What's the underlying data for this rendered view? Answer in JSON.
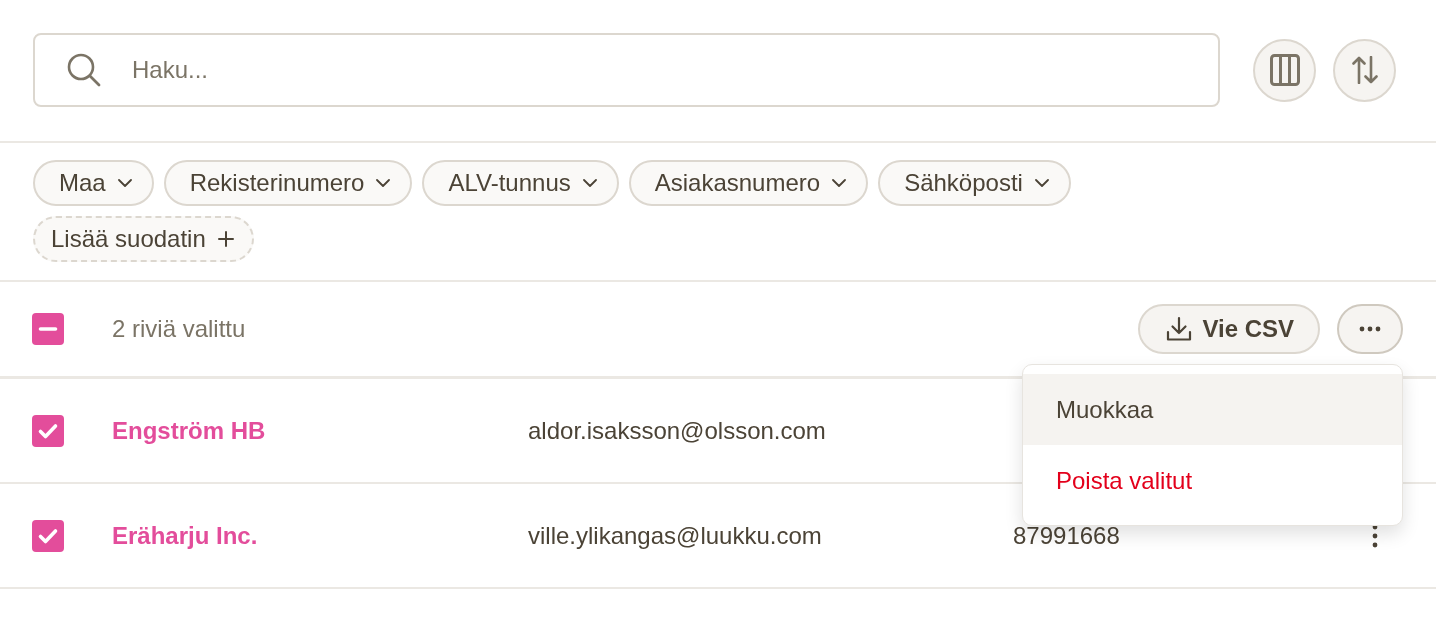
{
  "search": {
    "placeholder": "Haku..."
  },
  "view_buttons": [
    {
      "kind": "columns"
    },
    {
      "kind": "sort"
    }
  ],
  "filters": [
    {
      "label": "Maa",
      "kind": "dropdown"
    },
    {
      "label": "Rekisterinumero",
      "kind": "dropdown"
    },
    {
      "label": "ALV-tunnus",
      "kind": "dropdown"
    },
    {
      "label": "Asiakasnumero",
      "kind": "dropdown"
    },
    {
      "label": "Sähköposti",
      "kind": "dropdown"
    },
    {
      "label": "Lisää suodatin",
      "kind": "add"
    }
  ],
  "selection": {
    "indeterminate": true,
    "label": "2 riviä valittu"
  },
  "actions": {
    "export_label": "Vie CSV",
    "menu_open": true
  },
  "menu": [
    {
      "label": "Muokkaa",
      "kind": "normal",
      "highlighted": true
    },
    {
      "label": "Poista valitut",
      "kind": "danger",
      "highlighted": false
    }
  ],
  "rows": [
    {
      "checked": true,
      "name": "Engström HB",
      "email": "aldor.isaksson@olsson.com",
      "more_icon": false
    },
    {
      "checked": true,
      "name": "Eräharju Inc.",
      "email": "ville.ylikangas@luukku.com",
      "number": "87991668",
      "more_icon": true
    }
  ]
}
